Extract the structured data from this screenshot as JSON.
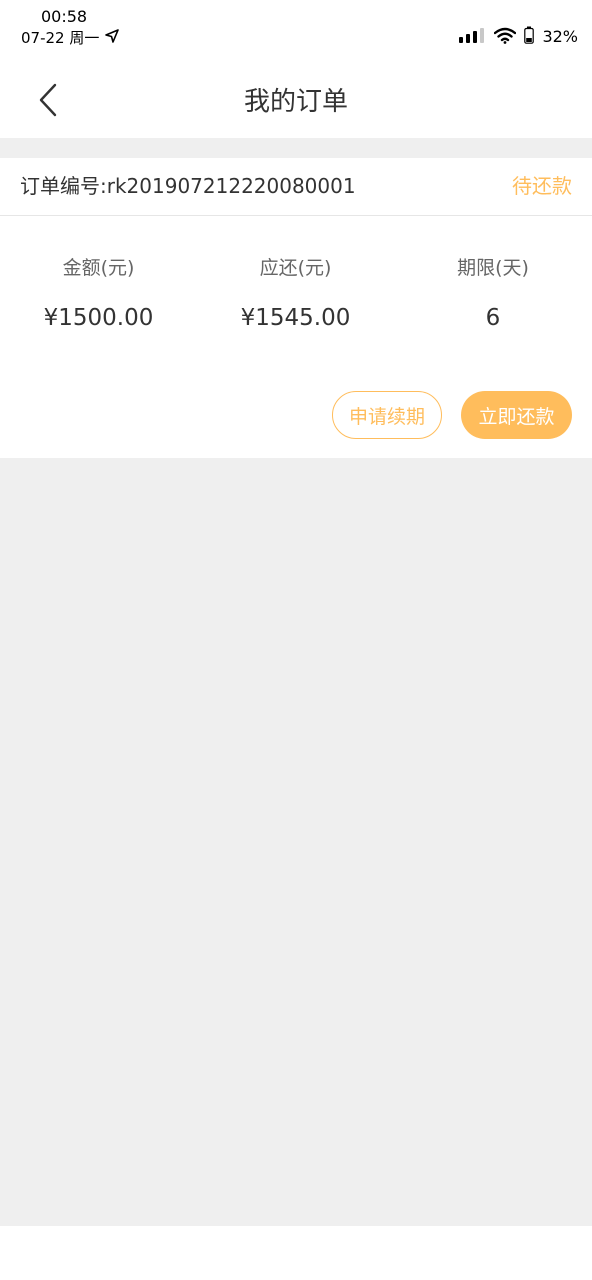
{
  "status_bar": {
    "time": "00:58",
    "date": "07-22 周一",
    "battery": "32%"
  },
  "nav": {
    "title": "我的订单"
  },
  "order": {
    "number_label": "订单编号:rk201907212220080001",
    "status": "待还款",
    "amount_label": "金额(元)",
    "amount_value": "¥1500.00",
    "due_label": "应还(元)",
    "due_value": "¥1545.00",
    "term_label": "期限(天)",
    "term_value": "6",
    "renew_label": "申请续期",
    "repay_label": "立即还款"
  },
  "colors": {
    "accent": "#ffbd5c",
    "background": "#efefef",
    "text": "#333333"
  }
}
